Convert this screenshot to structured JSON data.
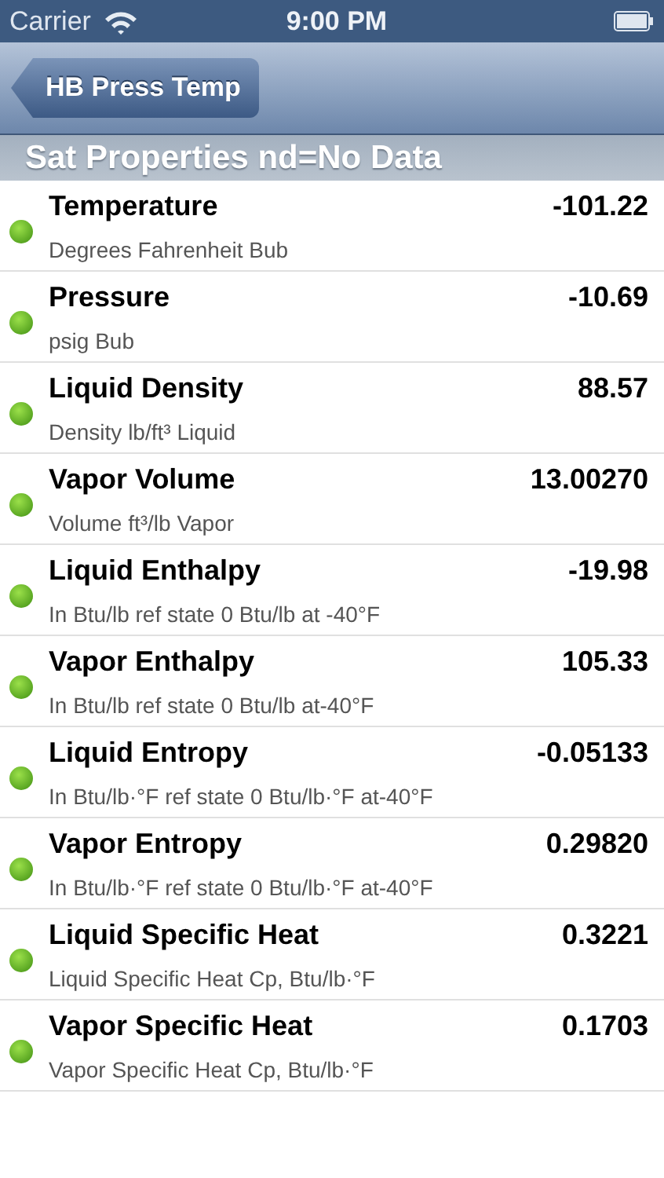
{
  "status_bar": {
    "carrier": "Carrier",
    "time": "9:00 PM"
  },
  "nav_bar": {
    "back_button": "HB Press Temp"
  },
  "section_header": "Sat Properties nd=No Data",
  "rows": [
    {
      "title": "Temperature",
      "subtitle": "Degrees Fahrenheit Bub",
      "value": "-101.22"
    },
    {
      "title": "Pressure",
      "subtitle": "psig Bub",
      "value": "-10.69"
    },
    {
      "title": "Liquid Density",
      "subtitle": "Density lb/ft³ Liquid",
      "value": "88.57"
    },
    {
      "title": "Vapor Volume",
      "subtitle": "Volume ft³/lb Vapor",
      "value": "13.00270"
    },
    {
      "title": "Liquid Enthalpy",
      "subtitle": "In Btu/lb ref state 0 Btu/lb at -40°F",
      "value": "-19.98"
    },
    {
      "title": "Vapor Enthalpy",
      "subtitle": "In Btu/lb ref state 0 Btu/lb at-40°F",
      "value": "105.33"
    },
    {
      "title": "Liquid Entropy",
      "subtitle": "In Btu/lb·°F ref state 0 Btu/lb·°F at-40°F",
      "value": "-0.05133"
    },
    {
      "title": "Vapor Entropy",
      "subtitle": "In Btu/lb·°F ref state 0 Btu/lb·°F at-40°F",
      "value": "0.29820"
    },
    {
      "title": "Liquid Specific Heat",
      "subtitle": "Liquid Specific Heat Cp, Btu/lb·°F",
      "value": "0.3221"
    },
    {
      "title": "Vapor Specific Heat",
      "subtitle": "Vapor Specific Heat Cp, Btu/lb·°F",
      "value": "0.1703"
    }
  ]
}
